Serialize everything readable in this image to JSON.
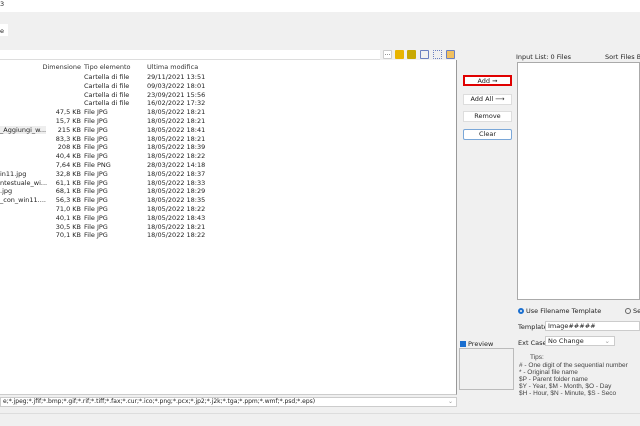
{
  "window": {
    "title_fragment": "3"
  },
  "tab": {
    "label": "e"
  },
  "toolbar_icons": [
    "ellipsis-button",
    "up-folder-icon",
    "refresh-folder-icon",
    "columns-view-icon",
    "grid-view-icon",
    "details-view-icon"
  ],
  "file_list": {
    "columns": [
      "Dimensione",
      "Tipo elemento",
      "Ultima modifica"
    ],
    "rows": [
      {
        "name": "",
        "size": "",
        "type": "Cartella di file",
        "modified": "29/11/2021 13:51"
      },
      {
        "name": "",
        "size": "",
        "type": "Cartella di file",
        "modified": "09/03/2022 18:01"
      },
      {
        "name": "",
        "size": "",
        "type": "Cartella di file",
        "modified": "23/09/2021 15:56"
      },
      {
        "name": "",
        "size": "",
        "type": "Cartella di file",
        "modified": "16/02/2022 17:32"
      },
      {
        "name": "",
        "size": "47,5 KB",
        "type": "File JPG",
        "modified": "18/05/2022 18:21"
      },
      {
        "name": "",
        "size": "15,7 KB",
        "type": "File JPG",
        "modified": "18/05/2022 18:21"
      },
      {
        "name": "_Aggiungi_w...",
        "size": "215 KB",
        "type": "File JPG",
        "modified": "18/05/2022 18:41"
      },
      {
        "name": "",
        "size": "83,3 KB",
        "type": "File JPG",
        "modified": "18/05/2022 18:21"
      },
      {
        "name": "",
        "size": "208 KB",
        "type": "File JPG",
        "modified": "18/05/2022 18:39"
      },
      {
        "name": "",
        "size": "40,4 KB",
        "type": "File JPG",
        "modified": "18/05/2022 18:22"
      },
      {
        "name": "",
        "size": "7,64 KB",
        "type": "File PNG",
        "modified": "28/03/2022 14:18"
      },
      {
        "name": "in11.jpg",
        "size": "32,8 KB",
        "type": "File JPG",
        "modified": "18/05/2022 18:37"
      },
      {
        "name": "ntestuale_wi...",
        "size": "61,1 KB",
        "type": "File JPG",
        "modified": "18/05/2022 18:33"
      },
      {
        "name": ".jpg",
        "size": "68,1 KB",
        "type": "File JPG",
        "modified": "18/05/2022 18:29"
      },
      {
        "name": "_con_win11....",
        "size": "56,3 KB",
        "type": "File JPG",
        "modified": "18/05/2022 18:35"
      },
      {
        "name": "",
        "size": "71,0 KB",
        "type": "File JPG",
        "modified": "18/05/2022 18:22"
      },
      {
        "name": "",
        "size": "40,1 KB",
        "type": "File JPG",
        "modified": "18/05/2022 18:43"
      },
      {
        "name": "",
        "size": "30,5 KB",
        "type": "File JPG",
        "modified": "18/05/2022 18:21"
      },
      {
        "name": "",
        "size": "70,1 KB",
        "type": "File JPG",
        "modified": "18/05/2022 18:22"
      }
    ]
  },
  "filter": {
    "value": "e;*.jpeg;*.jfif;*.bmp;*.gif;*.rif;*.tiff;*.fax;*.cur;*.ico;*.png;*.pcx;*.jp2;*.j2k;*.tga;*.ppm;*.wmf;*.psd;*.eps)"
  },
  "buttons": {
    "add": "Add ➞",
    "add_all": "Add All ⟶",
    "remove": "Remove",
    "clear": "Clear"
  },
  "input_list": {
    "label": "Input List: 0 Files",
    "sort_label": "Sort Files By:"
  },
  "naming": {
    "use_template": "Use Filename Template",
    "other_option": "Se",
    "template_label": "Template:",
    "template_value": "Image#####",
    "ext_case_label": "Ext Case:",
    "ext_case_value": "No Change"
  },
  "preview": {
    "label": "Preview"
  },
  "tips": {
    "title": "Tips:",
    "lines": [
      "#  - One digit of the sequential number",
      "*  - Original file name",
      "$P - Parent folder name",
      "$Y - Year,      $M - Month,     $O - Day",
      "$H - Hour,      $N - Minute,    $S - Seco"
    ]
  },
  "colors": {
    "highlight": "#e00000",
    "accent": "#1a6fd0"
  }
}
